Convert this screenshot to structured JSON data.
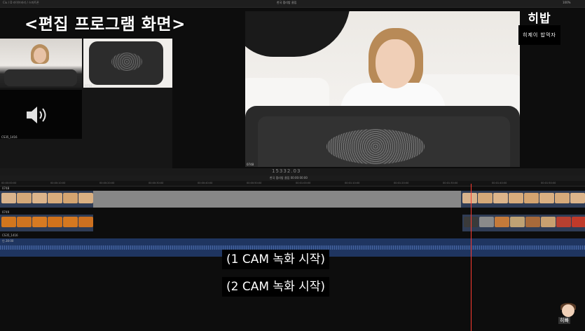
{
  "app": {
    "library_label": "Ciu / D 라이브러리 / 스마트폰",
    "project_title": "한국 펌리밥 클립",
    "zoom": "100%"
  },
  "overlay": {
    "title": "<편집 프로그램 화면>"
  },
  "browser": {
    "clips": [
      {
        "label": ""
      },
      {
        "label": "0714"
      },
      {
        "label": "CS35_1416"
      }
    ]
  },
  "viewer": {
    "timecode_label": "0748"
  },
  "logo": {
    "main": "히밥",
    "sub": "히제이 밥먹자"
  },
  "toolbar": {
    "timecode": "15332.03"
  },
  "timeline": {
    "project_name": "한국 펌리밥 클립  00:00:00:00",
    "ruler_ticks": [
      "00:00:00:00",
      "00:00:10:00",
      "00:00:20:00",
      "00:00:30:00",
      "00:00:40:00",
      "00:00:50:00",
      "00:01:00:00",
      "00:01:10:00",
      "00:01:20:00",
      "00:01:30:00",
      "00:01:40:00",
      "00:01:50:00"
    ],
    "tracks": [
      {
        "label": "0748"
      },
      {
        "label": "0749"
      },
      {
        "label": "CS35_1416"
      }
    ],
    "audio_role": "인.30:00"
  },
  "subtitles": {
    "line1": "(1 CAM 녹화 시작)",
    "line2": "(2 CAM 녹화 시작)"
  },
  "avatar": {
    "tag": "히빠"
  },
  "colors": {
    "playhead": "#ff3b30",
    "timeline_gap": "#878787",
    "audio_track": "#1f3560"
  }
}
